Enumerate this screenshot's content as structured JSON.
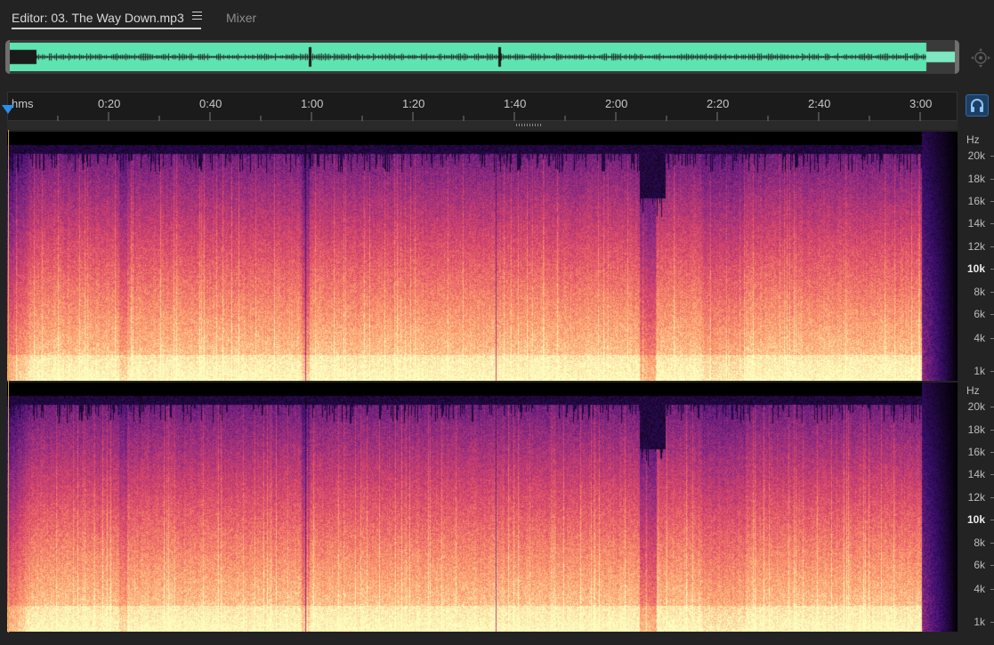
{
  "tabs": {
    "editor_label": "Editor: 03. The Way Down.mp3",
    "mixer_label": "Mixer"
  },
  "overview": {
    "wave_color": "#5ee4b0",
    "view_start_fraction": 0.0,
    "view_end_fraction": 1.0
  },
  "ruler": {
    "unit_label": "hms",
    "time_labels": [
      "0:20",
      "0:40",
      "1:00",
      "1:20",
      "1:40",
      "2:00",
      "2:20",
      "2:40",
      "3:00"
    ],
    "playhead_color": "#2b8ee8"
  },
  "spectral": {
    "left_channel": {
      "unit": "Hz",
      "freq_labels": [
        "20k",
        "18k",
        "16k",
        "14k",
        "12k",
        "10k",
        "8k",
        "6k",
        "4k",
        "1k"
      ],
      "bold_label": "10k"
    },
    "right_channel": {
      "unit": "Hz",
      "freq_labels": [
        "20k",
        "18k",
        "16k",
        "14k",
        "12k",
        "10k",
        "8k",
        "6k",
        "4k",
        "1k"
      ],
      "bold_label": "10k"
    },
    "colormap": [
      "#000000",
      "#3b0f6f",
      "#8c2981",
      "#de4968",
      "#fe9f6d",
      "#fcfdbf"
    ]
  },
  "icons": {
    "menu": "hamburger-menu-icon",
    "zoom_nav": "zoom-navigator-icon",
    "monitor": "headphones-icon"
  }
}
